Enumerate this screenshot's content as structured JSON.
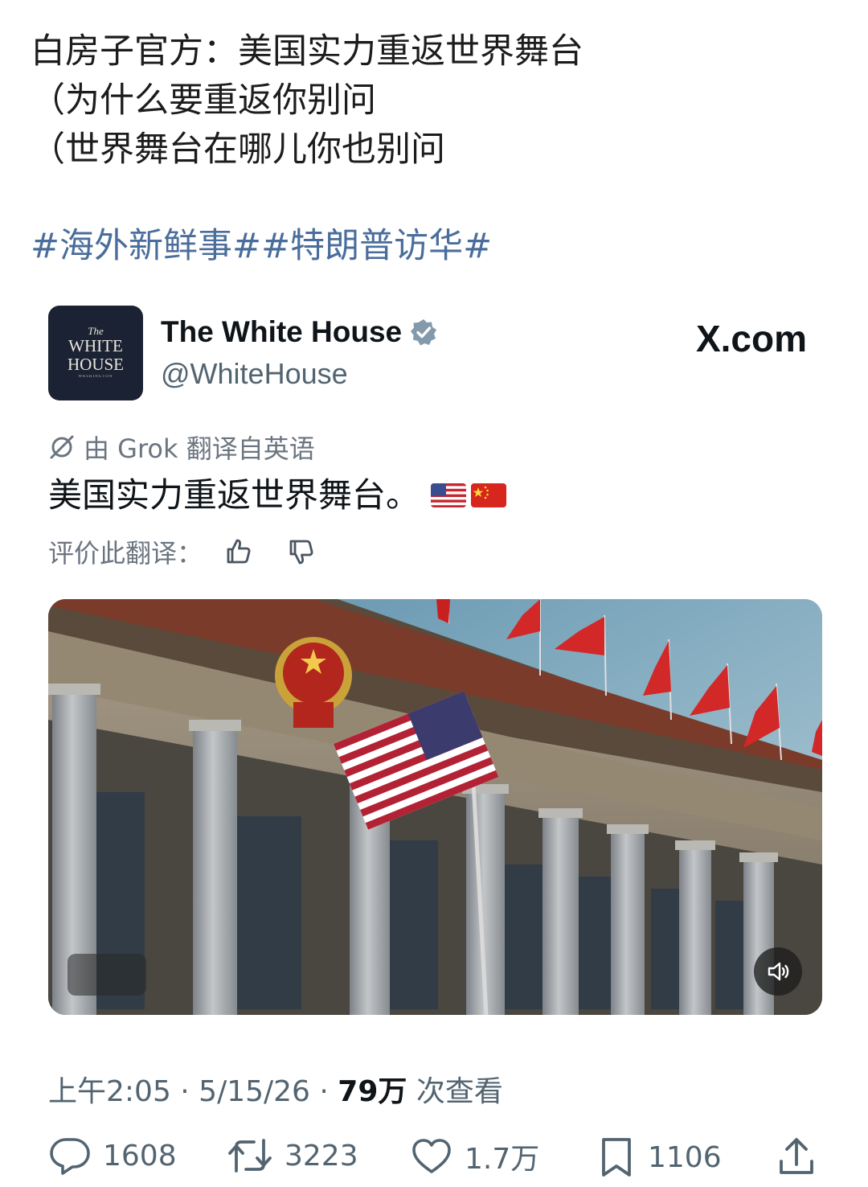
{
  "post": {
    "lines": [
      "白房子官方：美国实力重返世界舞台",
      "（为什么要重返你别问",
      "（世界舞台在哪儿你也别问"
    ],
    "hashtags": [
      "#海外新鲜事#",
      "#特朗普访华#"
    ]
  },
  "embed": {
    "avatar": {
      "the": "The",
      "line1": "WHITE",
      "line2": "HOUSE",
      "small": "WASHINGTON"
    },
    "display_name": "The White House",
    "handle": "@WhiteHouse",
    "source_logo": "X.com",
    "grok_label": "由 Grok 翻译自英语",
    "tweet_text": "美国实力重返世界舞台。",
    "rate_label": "评价此翻译：",
    "meta": {
      "time": "上午2:05 · 5/15/26 · ",
      "views_num": "79万",
      "views_suffix": " 次查看"
    },
    "actions": {
      "replies": "1608",
      "reposts": "3223",
      "likes": "1.7万",
      "bookmarks": "1106"
    },
    "icons": {
      "verified": "verified-badge-icon",
      "grok": "grok-icon",
      "thumb_up": "thumbs-up-icon",
      "thumb_down": "thumbs-down-icon",
      "speaker": "speaker-icon",
      "reply": "reply-icon",
      "repost": "repost-icon",
      "like": "heart-icon",
      "bookmark": "bookmark-icon",
      "share": "share-icon"
    },
    "colors": {
      "hashtag": "#4a6d9c",
      "verified": "#829aab",
      "flag_red": "#d6261d",
      "avatar_bg": "#1b2233"
    }
  }
}
